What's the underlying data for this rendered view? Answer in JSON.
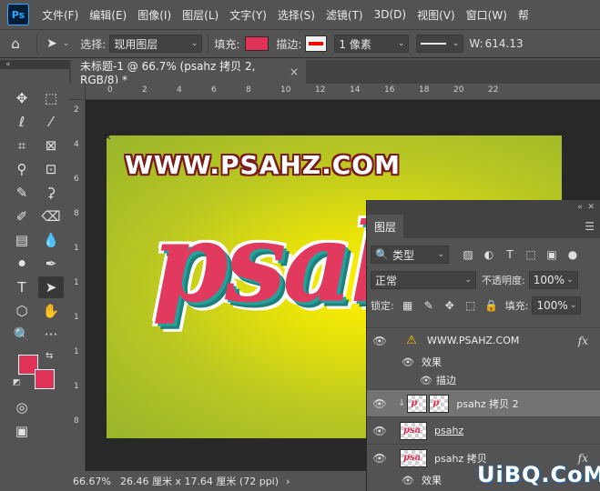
{
  "menubar": {
    "logo": "Ps",
    "items": [
      "文件(F)",
      "编辑(E)",
      "图像(I)",
      "图层(L)",
      "文字(Y)",
      "选择(S)",
      "滤镜(T)",
      "3D(D)",
      "视图(V)",
      "窗口(W)",
      "帮"
    ]
  },
  "options": {
    "select_label": "选择:",
    "select_value": "现用图层",
    "fill_label": "填充:",
    "fill_color": "#e03157",
    "stroke_label": "描边:",
    "stroke_width": "1 像素",
    "width_label": "W:",
    "width_value": "614.13"
  },
  "document": {
    "tab_title": "未标题-1 @ 66.7% (psahz 拷贝 2, RGB/8) *",
    "close": "×",
    "ruler_top": [
      "0",
      "2",
      "4",
      "6",
      "8",
      "10",
      "12",
      "14",
      "16",
      "18",
      "20",
      "22"
    ],
    "ruler_left": [
      "2",
      "4",
      "6",
      "8",
      "1",
      "1",
      "1",
      "1",
      "1",
      "8"
    ],
    "canvas_url_text": "WWW.PSAHZ.COM",
    "canvas_big_text": "psah"
  },
  "status": {
    "zoom": "66.67%",
    "doc_size": "26.46 厘米 x 17.64 厘米 (72 ppi)",
    "arrow": "›"
  },
  "layers_panel": {
    "tab": "图层",
    "filter_label": "类型",
    "blend_mode": "正常",
    "opacity_label": "不透明度:",
    "opacity_value": "100%",
    "lock_label": "锁定:",
    "fill_label": "填充:",
    "fill_value": "100%",
    "layers": [
      {
        "name": "WWW.PSAHZ.COM",
        "fx": "fx"
      },
      {
        "name": "效果"
      },
      {
        "name": "描边"
      },
      {
        "name": "psahz 拷贝 2"
      },
      {
        "name": "psahz"
      },
      {
        "name": "psahz 拷贝",
        "fx": "fx"
      },
      {
        "name": "效果"
      }
    ]
  },
  "watermark": "UiBQ.CoM"
}
